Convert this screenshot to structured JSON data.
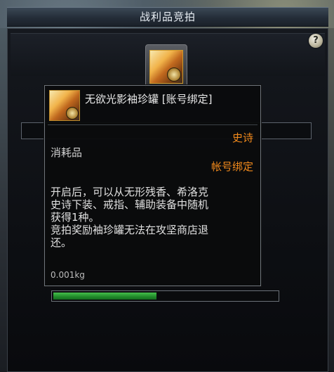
{
  "window": {
    "title": "战利品竞拍",
    "help_label": "?"
  },
  "tooltip": {
    "item_name": "无欲光影袖珍罐 [账号绑定]",
    "rarity": "史诗",
    "item_type": "消耗品",
    "binding": "帐号绑定",
    "description_lines": [
      "开启后，可以从无形残香、希洛克",
      "史诗下装、戒指、辅助装备中随机",
      "获得1种。",
      "竞拍奖励袖珍罐无法在攻坚商店退",
      "还。"
    ],
    "weight": "0.001kg"
  },
  "auction": {
    "progress_fraction": 0.46
  },
  "colors": {
    "rarity": "#f28a1c",
    "progress": "#2fa63a"
  },
  "icons": {
    "item": "pouch-item-icon",
    "help": "question-mark-icon"
  }
}
